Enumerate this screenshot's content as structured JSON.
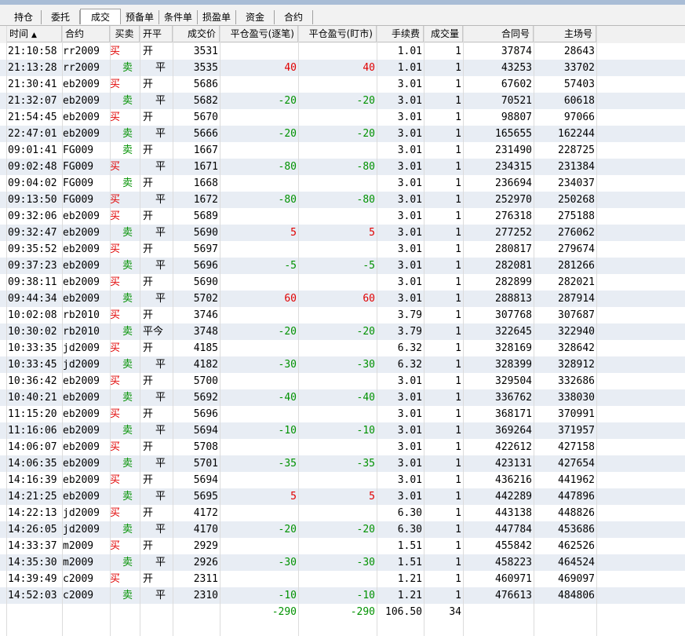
{
  "tabs": [
    {
      "label": "持仓",
      "active": false
    },
    {
      "label": "委托",
      "active": false
    },
    {
      "label": "成交",
      "active": true
    },
    {
      "label": "预备单",
      "active": false
    },
    {
      "label": "条件单",
      "active": false
    },
    {
      "label": "损盈单",
      "active": false
    },
    {
      "label": "资金",
      "active": false
    },
    {
      "label": "合约",
      "active": false
    }
  ],
  "columns": {
    "time": "时间",
    "contract": "合约",
    "side": "买卖",
    "open_close": "开平",
    "price": "成交价",
    "pnl_by_trade": "平仓盈亏(逐笔)",
    "pnl_mark": "平仓盈亏(盯市)",
    "fee": "手续费",
    "qty": "成交量",
    "contract_no": "合同号",
    "exchange_no": "主场号"
  },
  "sort_indicator": "▲",
  "colors": {
    "buy": "#e00000",
    "sell": "#009100",
    "profit": "#e00000",
    "loss": "#009100",
    "stripe": "#e8edf4"
  },
  "trades": [
    {
      "time": "21:10:58",
      "contract": "rr2009",
      "side": "买",
      "oc": "开",
      "price": "3531",
      "pnl1": "",
      "pnl2": "",
      "fee": "1.01",
      "qty": "1",
      "cno": "37874",
      "xno": "28643"
    },
    {
      "time": "21:13:28",
      "contract": "rr2009",
      "side": "卖",
      "oc": "平",
      "price": "3535",
      "pnl1": "40",
      "pnl2": "40",
      "fee": "1.01",
      "qty": "1",
      "cno": "43253",
      "xno": "33702"
    },
    {
      "time": "21:30:41",
      "contract": "eb2009",
      "side": "买",
      "oc": "开",
      "price": "5686",
      "pnl1": "",
      "pnl2": "",
      "fee": "3.01",
      "qty": "1",
      "cno": "67602",
      "xno": "57403"
    },
    {
      "time": "21:32:07",
      "contract": "eb2009",
      "side": "卖",
      "oc": "平",
      "price": "5682",
      "pnl1": "-20",
      "pnl2": "-20",
      "fee": "3.01",
      "qty": "1",
      "cno": "70521",
      "xno": "60618"
    },
    {
      "time": "21:54:45",
      "contract": "eb2009",
      "side": "买",
      "oc": "开",
      "price": "5670",
      "pnl1": "",
      "pnl2": "",
      "fee": "3.01",
      "qty": "1",
      "cno": "98807",
      "xno": "97066"
    },
    {
      "time": "22:47:01",
      "contract": "eb2009",
      "side": "卖",
      "oc": "平",
      "price": "5666",
      "pnl1": "-20",
      "pnl2": "-20",
      "fee": "3.01",
      "qty": "1",
      "cno": "165655",
      "xno": "162244"
    },
    {
      "time": "09:01:41",
      "contract": "FG009",
      "side": "卖",
      "oc": "开",
      "price": "1667",
      "pnl1": "",
      "pnl2": "",
      "fee": "3.01",
      "qty": "1",
      "cno": "231490",
      "xno": "228725"
    },
    {
      "time": "09:02:48",
      "contract": "FG009",
      "side": "买",
      "oc": "平",
      "price": "1671",
      "pnl1": "-80",
      "pnl2": "-80",
      "fee": "3.01",
      "qty": "1",
      "cno": "234315",
      "xno": "231384"
    },
    {
      "time": "09:04:02",
      "contract": "FG009",
      "side": "卖",
      "oc": "开",
      "price": "1668",
      "pnl1": "",
      "pnl2": "",
      "fee": "3.01",
      "qty": "1",
      "cno": "236694",
      "xno": "234037"
    },
    {
      "time": "09:13:50",
      "contract": "FG009",
      "side": "买",
      "oc": "平",
      "price": "1672",
      "pnl1": "-80",
      "pnl2": "-80",
      "fee": "3.01",
      "qty": "1",
      "cno": "252970",
      "xno": "250268"
    },
    {
      "time": "09:32:06",
      "contract": "eb2009",
      "side": "买",
      "oc": "开",
      "price": "5689",
      "pnl1": "",
      "pnl2": "",
      "fee": "3.01",
      "qty": "1",
      "cno": "276318",
      "xno": "275188"
    },
    {
      "time": "09:32:47",
      "contract": "eb2009",
      "side": "卖",
      "oc": "平",
      "price": "5690",
      "pnl1": "5",
      "pnl2": "5",
      "fee": "3.01",
      "qty": "1",
      "cno": "277252",
      "xno": "276062"
    },
    {
      "time": "09:35:52",
      "contract": "eb2009",
      "side": "买",
      "oc": "开",
      "price": "5697",
      "pnl1": "",
      "pnl2": "",
      "fee": "3.01",
      "qty": "1",
      "cno": "280817",
      "xno": "279674"
    },
    {
      "time": "09:37:23",
      "contract": "eb2009",
      "side": "卖",
      "oc": "平",
      "price": "5696",
      "pnl1": "-5",
      "pnl2": "-5",
      "fee": "3.01",
      "qty": "1",
      "cno": "282081",
      "xno": "281266"
    },
    {
      "time": "09:38:11",
      "contract": "eb2009",
      "side": "买",
      "oc": "开",
      "price": "5690",
      "pnl1": "",
      "pnl2": "",
      "fee": "3.01",
      "qty": "1",
      "cno": "282899",
      "xno": "282021"
    },
    {
      "time": "09:44:34",
      "contract": "eb2009",
      "side": "卖",
      "oc": "平",
      "price": "5702",
      "pnl1": "60",
      "pnl2": "60",
      "fee": "3.01",
      "qty": "1",
      "cno": "288813",
      "xno": "287914"
    },
    {
      "time": "10:02:08",
      "contract": "rb2010",
      "side": "买",
      "oc": "开",
      "price": "3746",
      "pnl1": "",
      "pnl2": "",
      "fee": "3.79",
      "qty": "1",
      "cno": "307768",
      "xno": "307687"
    },
    {
      "time": "10:30:02",
      "contract": "rb2010",
      "side": "卖",
      "oc": "平今",
      "price": "3748",
      "pnl1": "-20",
      "pnl2": "-20",
      "fee": "3.79",
      "qty": "1",
      "cno": "322645",
      "xno": "322940"
    },
    {
      "time": "10:33:35",
      "contract": "jd2009",
      "side": "买",
      "oc": "开",
      "price": "4185",
      "pnl1": "",
      "pnl2": "",
      "fee": "6.32",
      "qty": "1",
      "cno": "328169",
      "xno": "328642"
    },
    {
      "time": "10:33:45",
      "contract": "jd2009",
      "side": "卖",
      "oc": "平",
      "price": "4182",
      "pnl1": "-30",
      "pnl2": "-30",
      "fee": "6.32",
      "qty": "1",
      "cno": "328399",
      "xno": "328912"
    },
    {
      "time": "10:36:42",
      "contract": "eb2009",
      "side": "买",
      "oc": "开",
      "price": "5700",
      "pnl1": "",
      "pnl2": "",
      "fee": "3.01",
      "qty": "1",
      "cno": "329504",
      "xno": "332686"
    },
    {
      "time": "10:40:21",
      "contract": "eb2009",
      "side": "卖",
      "oc": "平",
      "price": "5692",
      "pnl1": "-40",
      "pnl2": "-40",
      "fee": "3.01",
      "qty": "1",
      "cno": "336762",
      "xno": "338030"
    },
    {
      "time": "11:15:20",
      "contract": "eb2009",
      "side": "买",
      "oc": "开",
      "price": "5696",
      "pnl1": "",
      "pnl2": "",
      "fee": "3.01",
      "qty": "1",
      "cno": "368171",
      "xno": "370991"
    },
    {
      "time": "11:16:06",
      "contract": "eb2009",
      "side": "卖",
      "oc": "平",
      "price": "5694",
      "pnl1": "-10",
      "pnl2": "-10",
      "fee": "3.01",
      "qty": "1",
      "cno": "369264",
      "xno": "371957"
    },
    {
      "time": "14:06:07",
      "contract": "eb2009",
      "side": "买",
      "oc": "开",
      "price": "5708",
      "pnl1": "",
      "pnl2": "",
      "fee": "3.01",
      "qty": "1",
      "cno": "422612",
      "xno": "427158"
    },
    {
      "time": "14:06:35",
      "contract": "eb2009",
      "side": "卖",
      "oc": "平",
      "price": "5701",
      "pnl1": "-35",
      "pnl2": "-35",
      "fee": "3.01",
      "qty": "1",
      "cno": "423131",
      "xno": "427654"
    },
    {
      "time": "14:16:39",
      "contract": "eb2009",
      "side": "买",
      "oc": "开",
      "price": "5694",
      "pnl1": "",
      "pnl2": "",
      "fee": "3.01",
      "qty": "1",
      "cno": "436216",
      "xno": "441962"
    },
    {
      "time": "14:21:25",
      "contract": "eb2009",
      "side": "卖",
      "oc": "平",
      "price": "5695",
      "pnl1": "5",
      "pnl2": "5",
      "fee": "3.01",
      "qty": "1",
      "cno": "442289",
      "xno": "447896"
    },
    {
      "time": "14:22:13",
      "contract": "jd2009",
      "side": "买",
      "oc": "开",
      "price": "4172",
      "pnl1": "",
      "pnl2": "",
      "fee": "6.30",
      "qty": "1",
      "cno": "443138",
      "xno": "448826"
    },
    {
      "time": "14:26:05",
      "contract": "jd2009",
      "side": "卖",
      "oc": "平",
      "price": "4170",
      "pnl1": "-20",
      "pnl2": "-20",
      "fee": "6.30",
      "qty": "1",
      "cno": "447784",
      "xno": "453686"
    },
    {
      "time": "14:33:37",
      "contract": "m2009",
      "side": "买",
      "oc": "开",
      "price": "2929",
      "pnl1": "",
      "pnl2": "",
      "fee": "1.51",
      "qty": "1",
      "cno": "455842",
      "xno": "462526"
    },
    {
      "time": "14:35:30",
      "contract": "m2009",
      "side": "卖",
      "oc": "平",
      "price": "2926",
      "pnl1": "-30",
      "pnl2": "-30",
      "fee": "1.51",
      "qty": "1",
      "cno": "458223",
      "xno": "464524"
    },
    {
      "time": "14:39:49",
      "contract": "c2009",
      "side": "买",
      "oc": "开",
      "price": "2311",
      "pnl1": "",
      "pnl2": "",
      "fee": "1.21",
      "qty": "1",
      "cno": "460971",
      "xno": "469097"
    },
    {
      "time": "14:52:03",
      "contract": "c2009",
      "side": "卖",
      "oc": "平",
      "price": "2310",
      "pnl1": "-10",
      "pnl2": "-10",
      "fee": "1.21",
      "qty": "1",
      "cno": "476613",
      "xno": "484806"
    }
  ],
  "totals": {
    "pnl1": "-290",
    "pnl2": "-290",
    "fee": "106.50",
    "qty": "34"
  }
}
